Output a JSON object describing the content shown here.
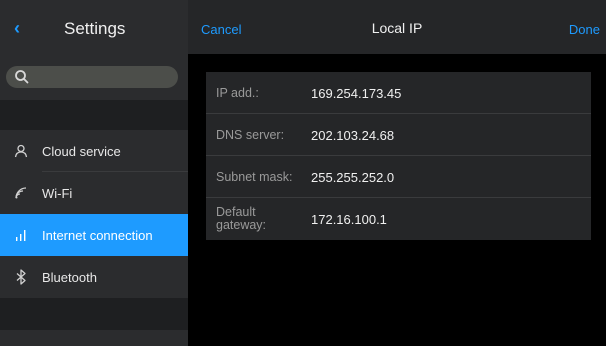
{
  "sidebar": {
    "title": "Settings",
    "back_icon": "chevron-left-icon",
    "search": {
      "placeholder": "",
      "icon": "search-icon"
    },
    "items": [
      {
        "label": "Cloud service",
        "icon": "person-icon",
        "active": false
      },
      {
        "label": "Wi-Fi",
        "icon": "wifi-icon",
        "active": false
      },
      {
        "label": "Internet connection",
        "icon": "signal-bars-icon",
        "active": true
      },
      {
        "label": "Bluetooth",
        "icon": "bluetooth-icon",
        "active": false
      }
    ]
  },
  "panel": {
    "cancel_label": "Cancel",
    "title": "Local IP",
    "done_label": "Done",
    "rows": [
      {
        "label": "IP add.:",
        "value": "169.254.173.45"
      },
      {
        "label": "DNS server:",
        "value": "202.103.24.68"
      },
      {
        "label": "Subnet mask:",
        "value": "255.255.252.0"
      },
      {
        "label": "Default gateway:",
        "value": "172.16.100.1"
      }
    ]
  },
  "colors": {
    "accent": "#1e9bff",
    "sidebar_bg": "#1e1f21",
    "row_bg": "#2b2c2e",
    "search_bg": "#4c4e4a"
  }
}
